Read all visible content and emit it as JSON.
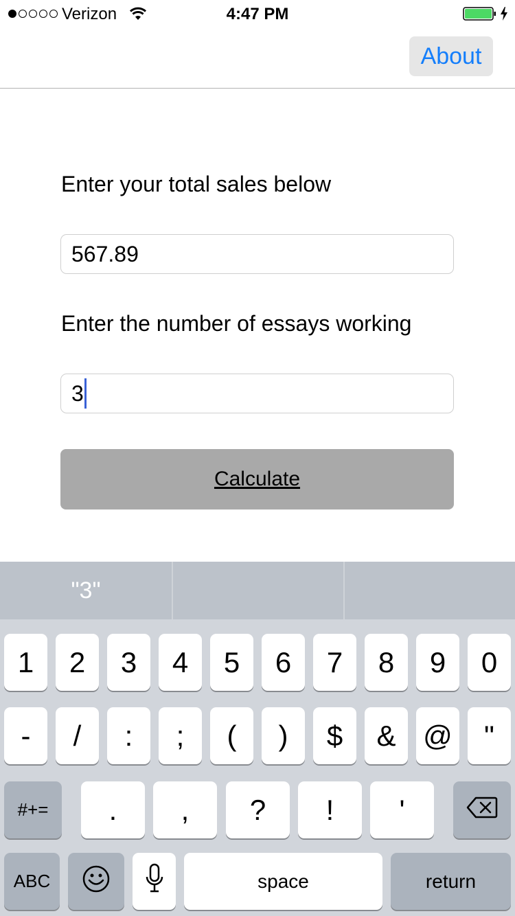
{
  "status_bar": {
    "carrier": "Verizon",
    "time": "4:47 PM",
    "signal_bars_filled": 1,
    "signal_bars_total": 5
  },
  "nav": {
    "about_label": "About"
  },
  "form": {
    "sales_label": "Enter your total sales below",
    "sales_value": "567.89",
    "essays_label": "Enter the number of essays working",
    "essays_value": "3",
    "calculate_label": "Calculate"
  },
  "keyboard": {
    "suggestions": [
      "\"3\"",
      "",
      ""
    ],
    "row1": [
      "1",
      "2",
      "3",
      "4",
      "5",
      "6",
      "7",
      "8",
      "9",
      "0"
    ],
    "row2": [
      "-",
      "/",
      ":",
      ";",
      "(",
      ")",
      "$",
      "&",
      "@",
      "\""
    ],
    "row3": {
      "symbols_label": "#+=",
      "keys": [
        ".",
        ",",
        "?",
        "!",
        "'"
      ],
      "delete_icon": "backspace-icon"
    },
    "row4": {
      "abc_label": "ABC",
      "emoji_icon": "emoji-icon",
      "mic_icon": "microphone-icon",
      "space_label": "space",
      "return_label": "return"
    }
  },
  "colors": {
    "accent": "#147efb",
    "battery": "#4cd964",
    "caret": "#3a62d6",
    "calculate_bg": "#a9a9a9"
  }
}
